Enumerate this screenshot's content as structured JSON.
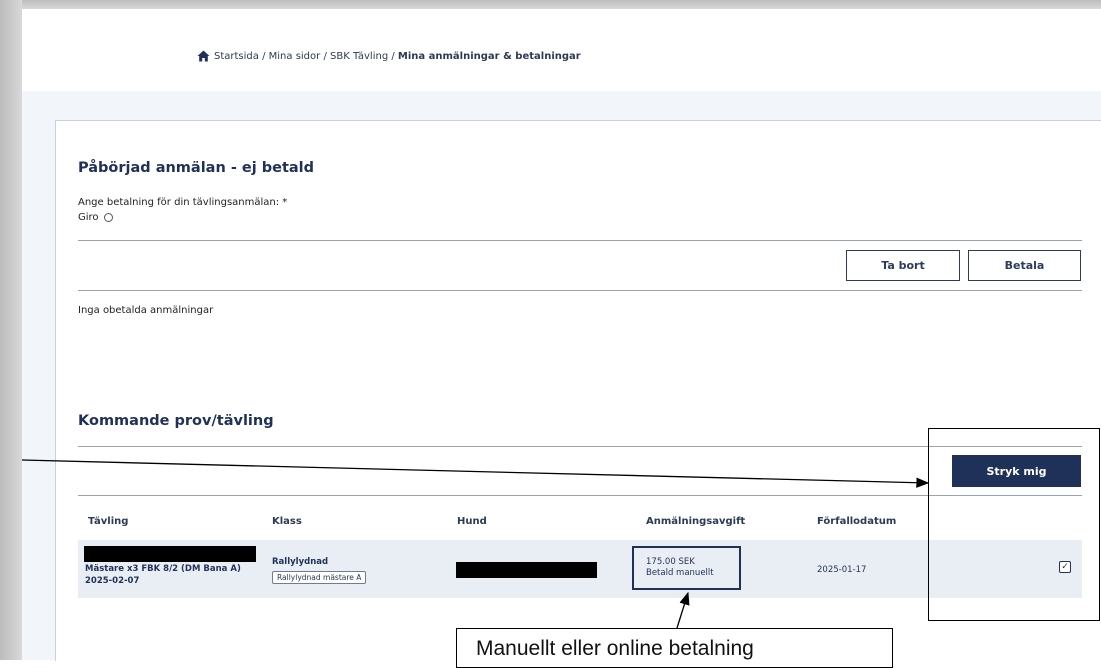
{
  "breadcrumb": {
    "home": "Startsida",
    "sep1": " / ",
    "mina_sidor": "Mina sidor",
    "sep2": " / ",
    "sbk": "SBK Tävling",
    "sep3": " / ",
    "current": "Mina anmälningar & betalningar"
  },
  "unpaid": {
    "title": "Påbörjad anmälan - ej betald",
    "payment_prompt": "Ange betalning för din tävlingsanmälan: *",
    "giro_label": "Giro",
    "delete_label": "Ta bort",
    "pay_label": "Betala",
    "empty_text": "Inga obetalda anmälningar"
  },
  "upcoming": {
    "title": "Kommande prov/tävling",
    "withdraw_label": "Stryk mig",
    "columns": [
      "Tävling",
      "Klass",
      "Hund",
      "Anmälningsavgift",
      "Förfallodatum"
    ],
    "rows": [
      {
        "competition": "Mästare x3 FBK 8/2 (DM Bana A)",
        "date": "2025-02-07",
        "class": "Rallylydnad",
        "class_tag": "Rallylydnad mästare A",
        "fee": "175.00 SEK",
        "fee_status": "Betald manuellt",
        "due_date": "2025-01-17",
        "checked": true
      }
    ]
  },
  "annotation": {
    "label": "Manuellt eller online betalning"
  },
  "colors": {
    "navy": "#1f3158",
    "page_bg": "#f2f5f9",
    "row_bg": "#e9eef5"
  },
  "icons": {
    "home": "home-icon",
    "radio": "radio-unchecked-icon",
    "checkbox": "checkbox-checked-icon"
  }
}
